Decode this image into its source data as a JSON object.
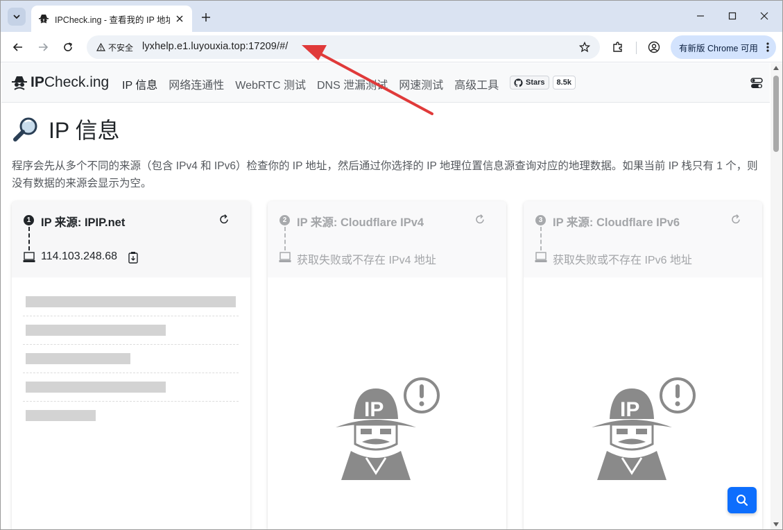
{
  "browser": {
    "tab_title": "IPCheck.ing - 查看我的 IP 地址",
    "security_label": "不安全",
    "url": "lyxhelp.e1.luyouxia.top:17209/#/",
    "update_label": "有新版 Chrome 可用"
  },
  "site": {
    "logo_bold": "IP",
    "logo_rest": "Check.ing",
    "menu": [
      "IP 信息",
      "网络连通性",
      "WebRTC 测试",
      "DNS 泄漏测试",
      "网速测试",
      "高级工具"
    ],
    "github_label": "Stars",
    "github_count": "8.5k"
  },
  "main": {
    "title": "IP 信息",
    "intro": "程序会先从多个不同的来源（包含 IPv4 和 IPv6）检查你的 IP 地址，然后通过你选择的 IP 地理位置信息源查询对应的地理数据。如果当前 IP 栈只有 1 个，则没有数据的来源会显示为空。"
  },
  "cards": [
    {
      "index": "1",
      "title": "IP 来源: IPIP.net",
      "ip": "114.103.248.68"
    },
    {
      "index": "2",
      "title": "IP 来源: Cloudflare IPv4",
      "ip": "获取失败或不存在 IPv4 地址"
    },
    {
      "index": "3",
      "title": "IP 来源: Cloudflare IPv6",
      "ip": "获取失败或不存在 IPv6 地址"
    }
  ],
  "icons": {
    "tab": "spy-favicon",
    "search_fab": "search-icon",
    "annotation": "red-arrow"
  },
  "colors": {
    "accent": "#0d6efd",
    "annotation_arrow": "#e03a3a",
    "skeleton": "#d3d3d3"
  }
}
